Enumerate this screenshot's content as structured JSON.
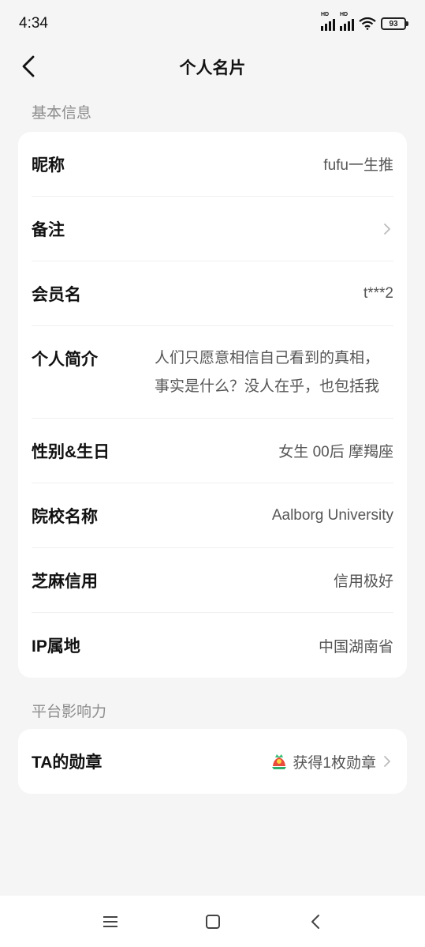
{
  "status": {
    "time": "4:34",
    "hd1": "HD",
    "hd2": "HD",
    "battery": "93"
  },
  "header": {
    "title": "个人名片",
    "back_icon": "chevron-left-icon"
  },
  "sections": {
    "basic_info_title": "基本信息",
    "influence_title": "平台影响力"
  },
  "profile": {
    "nickname_label": "昵称",
    "nickname_value": "fufu一生推",
    "remark_label": "备注",
    "member_label": "会员名",
    "member_value": "t***2",
    "bio_label": "个人简介",
    "bio_line1": "人们只愿意相信自己看到的真相，",
    "bio_line2": "事实是什么？没人在乎，也包括我",
    "gender_label": "性别&生日",
    "gender_value": "女生 00后 摩羯座",
    "school_label": "院校名称",
    "school_value": "Aalborg University",
    "credit_label": "芝麻信用",
    "credit_value": "信用极好",
    "ip_label": "IP属地",
    "ip_value": "中国湖南省"
  },
  "influence": {
    "medal_label": "TA的勋章",
    "medal_value": "获得1枚勋章"
  },
  "colors": {
    "background": "#f5f5f5",
    "card": "#ffffff",
    "label": "#111111",
    "value": "#555555",
    "section": "#8c8c8c"
  }
}
